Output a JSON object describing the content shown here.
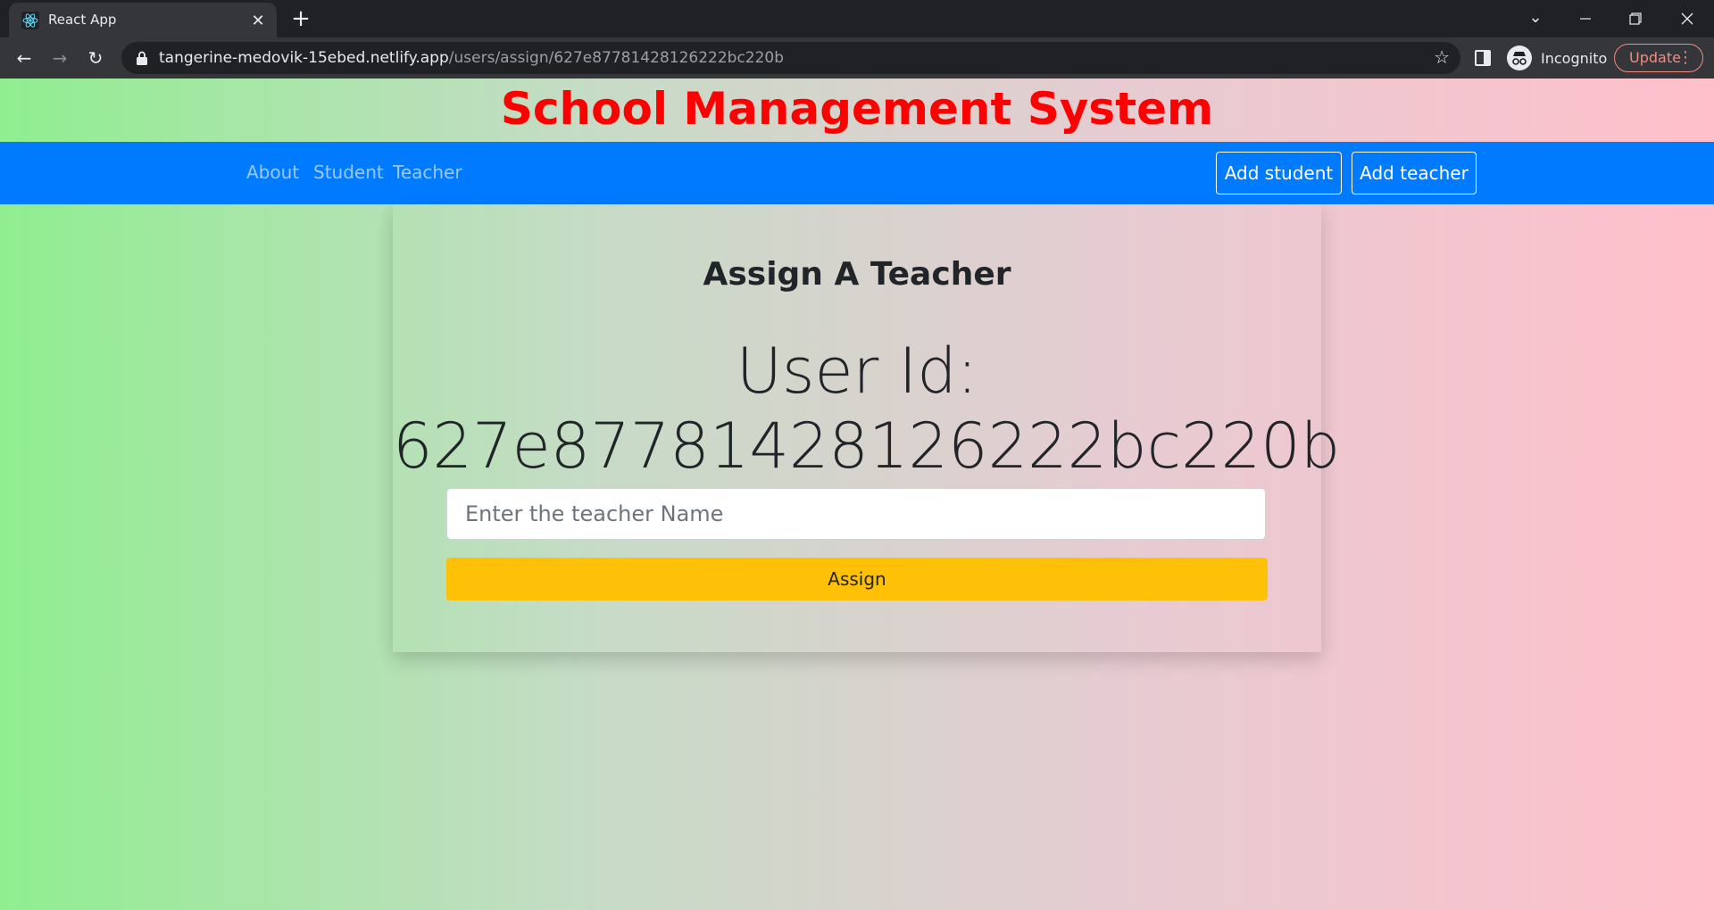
{
  "browser": {
    "tab_title": "React App",
    "new_tab_label": "+",
    "url_host": "tangerine-medovik-15ebed.netlify.app",
    "url_path": "/users/assign/627e87781428126222bc220b",
    "incognito_label": "Incognito",
    "update_label": "Update",
    "icons": [
      "react-favicon",
      "close-icon",
      "plus-icon",
      "chevron-down-icon",
      "minimize-icon",
      "restore-icon",
      "window-close-icon",
      "back-arrow-icon",
      "forward-arrow-icon",
      "reload-icon",
      "lock-icon",
      "star-icon",
      "side-panel-icon",
      "incognito-icon",
      "more-vert-icon"
    ]
  },
  "app": {
    "title": "School Management System",
    "title_color": "#ff0000",
    "nav_color": "#007bff",
    "nav_links": [
      "About",
      "Student",
      "Teacher"
    ],
    "nav_buttons": [
      "Add student",
      "Add teacher"
    ]
  },
  "card": {
    "heading": "Assign A Teacher",
    "user_id_label": "User Id:",
    "user_id_value": "627e87781428126222bc220b",
    "input_placeholder": "Enter the teacher Name",
    "input_value": "",
    "assign_label": "Assign",
    "assign_color": "#ffc107"
  }
}
